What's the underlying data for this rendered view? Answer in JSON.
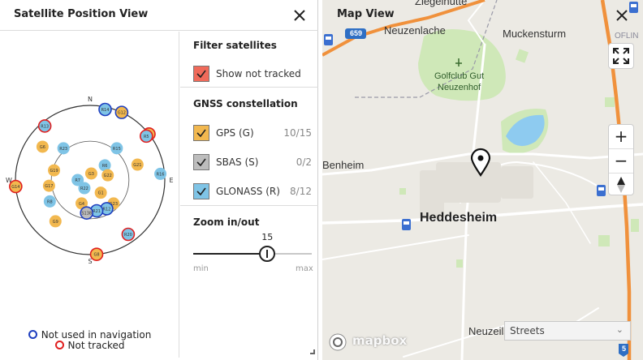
{
  "satellite_panel": {
    "title": "Satellite Position View",
    "directions": {
      "n": "N",
      "e": "E",
      "s": "S",
      "w": "W"
    },
    "legend": {
      "not_used": "Not used in navigation",
      "not_tracked": "Not tracked",
      "not_used_color": "#1f3fbf",
      "not_tracked_color": "#e02020"
    },
    "satellites": [
      {
        "id": "G12",
        "system": "GPS",
        "az": 25,
        "elev": 0,
        "not_used": true,
        "not_tracked": false
      },
      {
        "id": "R14",
        "system": "GLONASS",
        "az": 12,
        "elev": 3,
        "not_used": true,
        "not_tracked": false
      },
      {
        "id": "R13",
        "system": "GLONASS",
        "az": 320,
        "elev": 5,
        "not_used": false,
        "not_tracked": true
      },
      {
        "id": "G6",
        "system": "GPS",
        "az": 305,
        "elev": 20,
        "not_used": false,
        "not_tracked": false
      },
      {
        "id": "R23",
        "system": "GLONASS",
        "az": 320,
        "elev": 40,
        "not_used": false,
        "not_tracked": false
      },
      {
        "id": "R15",
        "system": "GLONASS",
        "az": 40,
        "elev": 40,
        "not_used": false,
        "not_tracked": false
      },
      {
        "id": "G",
        "system": "GPS",
        "az": 52,
        "elev": 0,
        "not_used": false,
        "not_tracked": true
      },
      {
        "id": "R5",
        "system": "GLONASS",
        "az": 52,
        "elev": 4,
        "not_used": false,
        "not_tracked": true
      },
      {
        "id": "R6",
        "system": "GLONASS",
        "az": 45,
        "elev": 65,
        "not_used": false,
        "not_tracked": false
      },
      {
        "id": "G21",
        "system": "GPS",
        "az": 72,
        "elev": 30,
        "not_used": false,
        "not_tracked": false
      },
      {
        "id": "R16",
        "system": "GLONASS",
        "az": 85,
        "elev": 5,
        "not_used": false,
        "not_tracked": false
      },
      {
        "id": "G19",
        "system": "GPS",
        "az": 285,
        "elev": 45,
        "not_used": false,
        "not_tracked": false
      },
      {
        "id": "G17",
        "system": "GPS",
        "az": 262,
        "elev": 40,
        "not_used": false,
        "not_tracked": false
      },
      {
        "id": "G14",
        "system": "GPS",
        "az": 265,
        "elev": 0,
        "not_used": false,
        "not_tracked": true
      },
      {
        "id": "R8",
        "system": "GLONASS",
        "az": 242,
        "elev": 35,
        "not_used": false,
        "not_tracked": false
      },
      {
        "id": "R7",
        "system": "GLONASS",
        "az": 270,
        "elev": 75,
        "not_used": false,
        "not_tracked": false
      },
      {
        "id": "G3",
        "system": "GPS",
        "az": 10,
        "elev": 82,
        "not_used": false,
        "not_tracked": false
      },
      {
        "id": "R22",
        "system": "GLONASS",
        "az": 215,
        "elev": 78,
        "not_used": false,
        "not_tracked": false
      },
      {
        "id": "G22",
        "system": "GPS",
        "az": 75,
        "elev": 68,
        "not_used": false,
        "not_tracked": false
      },
      {
        "id": "G1",
        "system": "GPS",
        "az": 140,
        "elev": 70,
        "not_used": false,
        "not_tracked": false
      },
      {
        "id": "G23",
        "system": "GPS",
        "az": 135,
        "elev": 50,
        "not_used": false,
        "not_tracked": false
      },
      {
        "id": "G4",
        "system": "GPS",
        "az": 200,
        "elev": 60,
        "not_used": false,
        "not_tracked": false
      },
      {
        "id": "R12",
        "system": "GLONASS",
        "az": 150,
        "elev": 50,
        "not_used": true,
        "not_tracked": false
      },
      {
        "id": "R21",
        "system": "GLONASS",
        "az": 168,
        "elev": 52,
        "not_used": true,
        "not_tracked": false
      },
      {
        "id": "S138",
        "system": "SBAS",
        "az": 186,
        "elev": 50,
        "not_used": true,
        "not_tracked": false
      },
      {
        "id": "G9",
        "system": "GPS",
        "az": 220,
        "elev": 25,
        "not_used": false,
        "not_tracked": false
      },
      {
        "id": "R20",
        "system": "GLONASS",
        "az": 145,
        "elev": 10,
        "not_used": false,
        "not_tracked": true
      },
      {
        "id": "G8",
        "system": "GPS",
        "az": 175,
        "elev": 0,
        "not_used": false,
        "not_tracked": true
      }
    ],
    "filter": {
      "title": "Filter satellites",
      "show_not_tracked_label": "Show not tracked",
      "show_not_tracked_checked": true,
      "color": "#f06a5a"
    },
    "constellation": {
      "title": "GNSS constellation",
      "items": [
        {
          "label": "GPS (G)",
          "count": "10/15",
          "color": "#f2b84f",
          "checked": true
        },
        {
          "label": "SBAS (S)",
          "count": "0/2",
          "color": "#bdbdbd",
          "checked": true
        },
        {
          "label": "GLONASS (R)",
          "count": "8/12",
          "color": "#7fc4e6",
          "checked": true
        }
      ]
    },
    "zoom": {
      "title": "Zoom in/out",
      "value": 15,
      "value_label": "15",
      "min": 0,
      "max": 24,
      "min_label": "min",
      "max_label": "max"
    }
  },
  "map_panel": {
    "title": "Map View",
    "places": {
      "ziegelhuette": "Ziegelhütte",
      "neuzenlache": "Neuzenlache",
      "muckensturm": "Muckensturm",
      "oflin": "OFLIN",
      "golfclub": "Golfclub Gut",
      "neuzenhof": "Neuzenhof",
      "benheim": "Benheim",
      "heddesheim": "Heddesheim",
      "neuzeilsheim": "Neuzeilsheim"
    },
    "road_shields": {
      "b38a": "659",
      "a5": "5"
    },
    "zoom_in": "+",
    "zoom_out": "−",
    "style_select": "Streets",
    "attribution": "mapbox",
    "colors": {
      "land": "#eceae4",
      "park": "#cfe8b8",
      "water": "#8ecbf0",
      "motorway": "#f0913c",
      "road": "#ffffff"
    }
  }
}
